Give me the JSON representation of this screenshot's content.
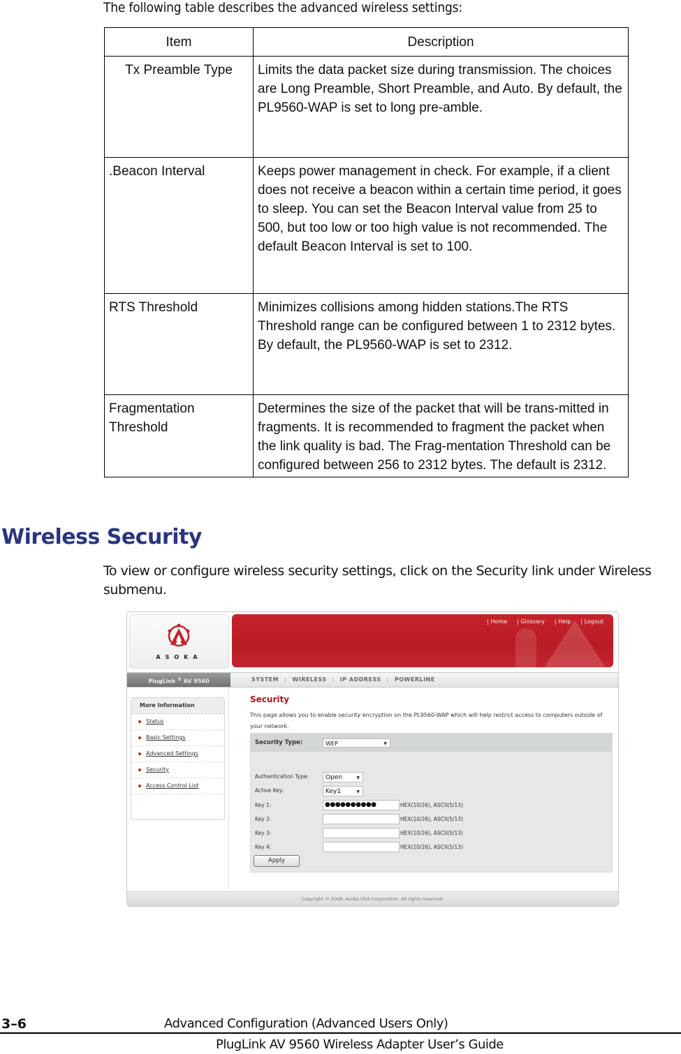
{
  "intro_text": "The following table describes the advanced wireless settings:",
  "table": {
    "headers": [
      "Item",
      "Description"
    ],
    "rows": [
      {
        "item": "Tx Preamble Type",
        "description": "Limits the data packet size during transmission. The choices are Long Preamble, Short Preamble, and Auto. By default, the PL9560-WAP is set to long pre-amble."
      },
      {
        "item": ".Beacon Interval",
        "description": "Keeps power management in check. For example, if a client does not receive a beacon within a certain time period, it goes to sleep. You can set the Beacon Interval value from 25 to 500, but too low or too high value is not recommended. The default Beacon Interval is set to 100."
      },
      {
        "item": "RTS Threshold",
        "description": "Minimizes collisions among hidden stations.The RTS Threshold range can be configured between 1 to 2312 bytes. By default, the PL9560-WAP is set to 2312."
      },
      {
        "item": "Fragmentation Threshold",
        "description": "Determines the size of the packet that will be trans-mitted in fragments. It is recommended to fragment the packet when the link quality is bad. The Frag-mentation Threshold can be configured between 256 to 2312 bytes. The default is 2312."
      }
    ]
  },
  "section": {
    "heading": "Wireless Security",
    "paragraph": "To view or configure wireless security settings, click on the Security link under Wireless submenu."
  },
  "screenshot": {
    "logo_text": "ASOKA",
    "top_links": [
      "| Home",
      "| Glossary",
      "| Help",
      "| Logout"
    ],
    "brand": {
      "name": "PlugLink",
      "reg": "®",
      "model": "AV 9560"
    },
    "nav": [
      "SYSTEM",
      "WIRELESS",
      "IP ADDRESS",
      "POWERLINE"
    ],
    "nav_separator": "|",
    "sidebar": {
      "title": "More Information",
      "items": [
        "Status",
        "Basic Settings",
        "Advanced Settings",
        "Security",
        "Access Control List"
      ]
    },
    "content": {
      "title": "Security",
      "description": "This page allows you to enable security encryption on the PL9560-WAP which will help restrict access to computers outside of your network.",
      "security_type_label": "Security Type:",
      "security_type_value": "WEP",
      "auth_type_label": "Authentication Type:",
      "auth_type_value": "Open",
      "active_key_label": "Active Key:",
      "active_key_value": "Key1",
      "keys": [
        {
          "label": "Key 1:",
          "value": "●●●●●●●●●●",
          "hint": "HEX(10/26), ASCII(5/13)"
        },
        {
          "label": "Key 2:",
          "value": "",
          "hint": "HEX(10/26), ASCII(5/13)"
        },
        {
          "label": "Key 3:",
          "value": "",
          "hint": "HEX(10/26), ASCII(5/13)"
        },
        {
          "label": "Key 4:",
          "value": "",
          "hint": "HEX(10/26), ASCII(5/13)"
        }
      ],
      "apply_label": "Apply"
    },
    "copyright": "Copyright © 2008. Asoka USA Corporation. All rights reserved.",
    "colors": {
      "brand_red": "#c4232b",
      "title_red": "#b3121c"
    }
  },
  "footer": {
    "page_number": "3–6",
    "chapter": "Advanced Configuration (Advanced Users Only)",
    "guide_title": "PlugLink AV 9560 Wireless Adapter User’s Guide"
  },
  "colors": {
    "heading_blue": "#2a3580"
  }
}
